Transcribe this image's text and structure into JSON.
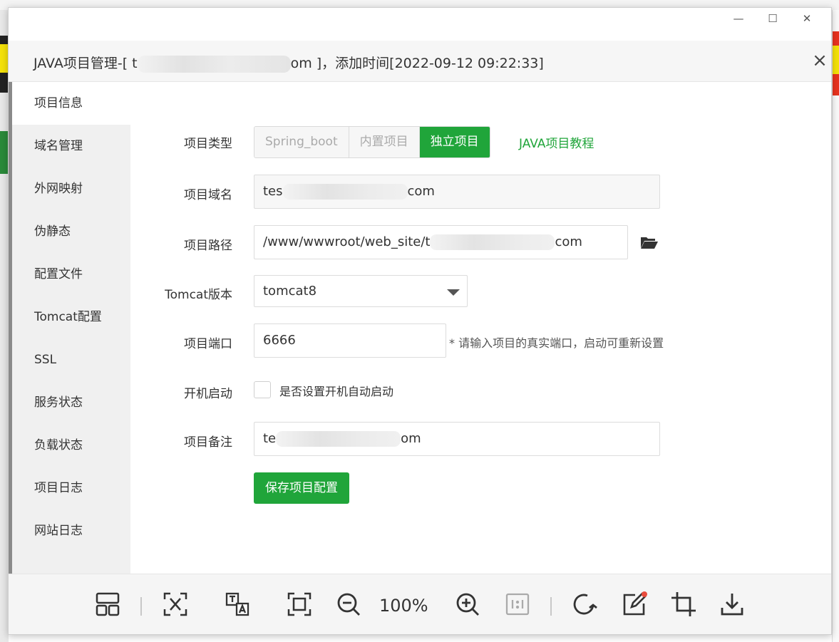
{
  "dialog": {
    "title_prefix": "JAVA项目管理-[ t",
    "title_suffix": "om ]，添加时间[2022-09-12 09:22:33]",
    "close": "×"
  },
  "window_controls": {
    "minimize": "—",
    "maximize": "☐",
    "close": "✕"
  },
  "sidebar": {
    "items": [
      {
        "label": "项目信息"
      },
      {
        "label": "域名管理"
      },
      {
        "label": "外网映射"
      },
      {
        "label": "伪静态"
      },
      {
        "label": "配置文件"
      },
      {
        "label": "Tomcat配置"
      },
      {
        "label": "SSL"
      },
      {
        "label": "服务状态"
      },
      {
        "label": "负载状态"
      },
      {
        "label": "项目日志"
      },
      {
        "label": "网站日志"
      }
    ],
    "active_index": 0
  },
  "form": {
    "type": {
      "label": "项目类型",
      "options": [
        "Spring_boot",
        "内置项目",
        "独立项目"
      ],
      "selected": "独立项目",
      "tutorial_link": "JAVA项目教程"
    },
    "domain": {
      "label": "项目域名",
      "value_prefix": "tes",
      "value_suffix": "com"
    },
    "path": {
      "label": "项目路径",
      "value_prefix": "/www/wwwroot/web_site/t",
      "value_suffix": "com"
    },
    "tomcat": {
      "label": "Tomcat版本",
      "value": "tomcat8"
    },
    "port": {
      "label": "项目端口",
      "value": "6666",
      "hint": "* 请输入项目的真实端口，启动可重新设置"
    },
    "autostart": {
      "label": "开机启动",
      "checkbox_label": "是否设置开机自动启动",
      "checked": false
    },
    "remark": {
      "label": "项目备注",
      "value_prefix": "te",
      "value_suffix": "om"
    },
    "save_label": "保存项目配置"
  },
  "toolbar": {
    "zoom": "100%",
    "icons": [
      "thumbnails-icon",
      "text-extract-icon",
      "translate-icon",
      "fit-screen-icon",
      "zoom-out-icon",
      "zoom-in-icon",
      "actual-size-icon",
      "rotate-icon",
      "edit-icon",
      "crop-icon",
      "download-icon"
    ]
  },
  "colors": {
    "accent": "#20a53a",
    "sidebar_bg": "#f0f0f0",
    "header_bg": "#f6f6f6"
  }
}
